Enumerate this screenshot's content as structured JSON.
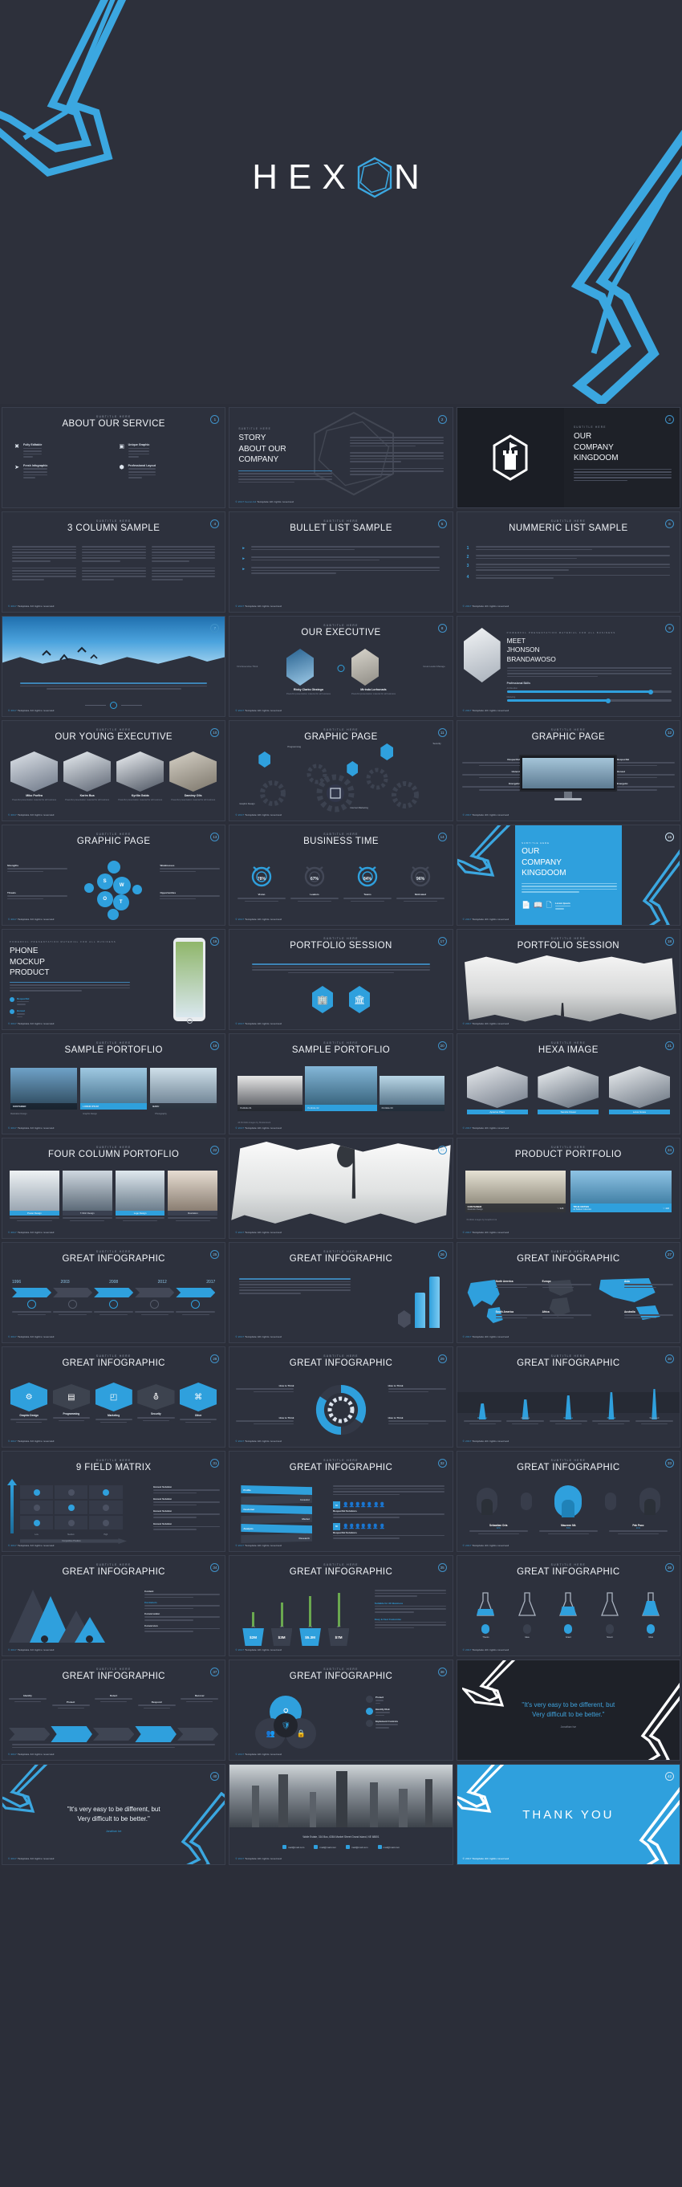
{
  "hero": {
    "brand_prefix": "HEX",
    "brand_suffix": "N",
    "brand_full": "HEXON",
    "accent_color": "#2fa0dd",
    "background_color": "#2d303b"
  },
  "common": {
    "subtitle_label": "SUBTITLE HERE",
    "footer_year": "© 2017",
    "footer_brand": "hexon.ltd",
    "footer_rights": "Template All rights reserved",
    "lorem_short": "Bring your business to the next Level with Powerful presentation material for all business and personal presentation.",
    "lorem_long": "Bring your business to the next Level with Powerful presentation material for all business. Suitable for all categories business and personal presentation If you are going to use a passage of Lorem Ipsum."
  },
  "slides": [
    {
      "number": "1",
      "subtitle": "SUBTITLE HERE",
      "title": "ABOUT OUR SERVICE",
      "type": "features",
      "features": [
        {
          "icon": "scissors-icon",
          "glyph": "✂",
          "label": "Fully Editable"
        },
        {
          "icon": "image-icon",
          "glyph": "▣",
          "label": "Unique Graphic"
        },
        {
          "icon": "rocket-icon",
          "glyph": "➤",
          "label": "Fresh Infographic"
        },
        {
          "icon": "layers-icon",
          "glyph": "⬢",
          "label": "Professional Layout"
        }
      ]
    },
    {
      "number": "2",
      "subtitle": "SUBTITLE HERE",
      "title": "STORY ABOUT OUR COMPANY",
      "title_lines": [
        "STORY",
        "ABOUT OUR",
        "COMPANY"
      ],
      "type": "story"
    },
    {
      "number": "3",
      "subtitle": "SUBTITLE HERE",
      "title": "OUR COMPANY KINGDOOM",
      "title_lines": [
        "OUR",
        "COMPANY",
        "KINGDOOM"
      ],
      "type": "company-kingdom",
      "icon": "castle-hex-icon"
    },
    {
      "number": "4",
      "subtitle": "SUBTITLE HERE",
      "title": "3 COLUMN SAMPLE",
      "type": "three-column"
    },
    {
      "number": "5",
      "subtitle": "SUBTITLE HERE",
      "title": "BULLET LIST SAMPLE",
      "type": "bullet-list",
      "bullet_glyph": "▸"
    },
    {
      "number": "6",
      "subtitle": "SUBTITLE HERE",
      "title": "NUMMERIC LIST SAMPLE",
      "type": "numeric-list",
      "numbers": [
        "1",
        "2",
        "3",
        "4"
      ]
    },
    {
      "number": "7",
      "subtitle": "",
      "title": "",
      "type": "image-brush-sky",
      "caption": "Bring your business to the next Level with Powerful presentation material for all business and personal presentation."
    },
    {
      "number": "8",
      "subtitle": "SUBTITLE HERE",
      "title": "OUR EXECUTIVE",
      "type": "executive",
      "people": [
        {
          "name": "Ricky Clarks Obstego",
          "role": "Powerful presentation material for all business"
        },
        {
          "name": "Mirinda Lorhonads",
          "role": "Powerful presentation material for all business"
        }
      ],
      "left_label": "First Executive Think",
      "right_label": "Great Leader Manage"
    },
    {
      "number": "9",
      "subtitle": "Powerful presentation material for all business",
      "title": "MEET JHONSON BRANDAWOSO",
      "title_lines": [
        "MEET",
        "JHONSON",
        "BRANDAWOSO"
      ],
      "type": "profile",
      "skills_label": "Professional Skills",
      "skills": [
        {
          "label": "Art Direction",
          "value": 88
        },
        {
          "label": "Marketing",
          "value": 62
        }
      ]
    },
    {
      "number": "10",
      "subtitle": "SUBTITLE HERE",
      "title": "OUR YOUNG EXECUTIVE",
      "type": "team",
      "members": [
        {
          "name": "Miko Porfira",
          "role": "Powerful presentation material for all business"
        },
        {
          "name": "Karim Bua",
          "role": "Powerful presentation material for all business"
        },
        {
          "name": "Kyrilla Gaida",
          "role": "Powerful presentation material for all business"
        },
        {
          "name": "Damimy Olis",
          "role": "Powerful presentation material for all business"
        }
      ]
    },
    {
      "number": "11",
      "subtitle": "SUBTITLE HERE",
      "title": "GRAPHIC PAGE",
      "type": "gears",
      "nodes": [
        "Programming",
        "Security",
        "Graphic Design",
        "Internet Marketing"
      ]
    },
    {
      "number": "12",
      "subtitle": "SUBTITLE HERE",
      "title": "GRAPHIC PAGE",
      "type": "monitor",
      "items": [
        "Respectful",
        "Honest",
        "Energetic",
        "Respectful",
        "Honest",
        "Energetic"
      ]
    },
    {
      "number": "13",
      "subtitle": "SUBTITLE HERE",
      "title": "GRAPHIC PAGE",
      "type": "swot",
      "swot_letters": [
        "S",
        "W",
        "O",
        "T"
      ],
      "swot_labels": [
        "Strengths",
        "Weaknesses",
        "Threats",
        "Opportunities"
      ]
    },
    {
      "number": "14",
      "subtitle": "SUBTITLE HERE",
      "title": "BUSINESS TIME",
      "type": "clocks",
      "clocks": [
        {
          "pct": "78%",
          "label": "Vision"
        },
        {
          "pct": "67%",
          "label": "Leaders"
        },
        {
          "pct": "84%",
          "label": "Teams"
        },
        {
          "pct": "96%",
          "label": "Motivated"
        }
      ]
    },
    {
      "number": "15",
      "subtitle": "SUBTITLE HERE",
      "title": "OUR COMPANY KINGDOOM",
      "title_lines": [
        "OUR",
        "COMPANY",
        "KINGDOOM"
      ],
      "type": "blue-panel",
      "caption": "Lorem Ipsum"
    },
    {
      "number": "16",
      "subtitle": "Powerful presentation material for all business",
      "title": "PHONE MOCKUP PRODUCT",
      "title_lines": [
        "PHONE",
        "MOCKUP",
        "PRODUCT"
      ],
      "type": "phone",
      "points": [
        "Respectful",
        "Honest"
      ]
    },
    {
      "number": "17",
      "subtitle": "SUBTITLE HERE",
      "title": "PORTFOLIO SESSION",
      "type": "portfolio-icons",
      "icons": [
        "building-icon",
        "bank-icon"
      ]
    },
    {
      "number": "18",
      "subtitle": "SUBTITLE HERE",
      "title": "PORTFOLIO SESSION",
      "type": "brush-photo"
    },
    {
      "number": "19",
      "subtitle": "SUBTITLE HERE",
      "title": "SAMPLE PORTOFLIO",
      "type": "gallery3",
      "items": [
        {
          "tag": "KONTAINER",
          "sub": "Illustration Design"
        },
        {
          "tag": "LOREM IPSUM",
          "sub": "Graphic Design"
        },
        {
          "tag": "BAKU",
          "sub": "Photography"
        }
      ]
    },
    {
      "number": "20",
      "subtitle": "SUBTITLE HERE",
      "title": "SAMPLE PORTOFLIO",
      "type": "gallery-wide",
      "items": [
        "Portfolio 01",
        "Portfolio 02",
        "Portfolio 03"
      ],
      "note": "All Portfolio images by Shutterstock"
    },
    {
      "number": "21",
      "subtitle": "SUBTITLE HERE",
      "title": "HEXA IMAGE",
      "type": "hexa-gallery",
      "items": [
        "Aplerica Plant",
        "Sandra Flower",
        "Lotus Grace"
      ]
    },
    {
      "number": "22",
      "subtitle": "SUBTITLE HERE",
      "title": "FOUR COLUMN PORTOFLIO",
      "type": "four-column",
      "items": [
        {
          "tag": "Poster Design",
          "sub": "Suitable for all categories business and personal presentation"
        },
        {
          "tag": "T-Shirt Design",
          "sub": "Suitable for all categories business and personal presentation"
        },
        {
          "tag": "Logo Design",
          "sub": "Suitable for all categories business and personal presentation"
        },
        {
          "tag": "Illustration",
          "sub": "Suitable for all categories business and personal presentation"
        }
      ]
    },
    {
      "number": "23",
      "subtitle": "",
      "title": "",
      "type": "brush-tree"
    },
    {
      "number": "24",
      "subtitle": "SUBTITLE HERE",
      "title": "PRODUCT PORTFOLIO",
      "type": "product-portfolio",
      "items": [
        {
          "tag": "KONTAINER",
          "sub": "Illustration Design",
          "likes": "328"
        },
        {
          "tag": "TRUE NOTEN",
          "sub": "Air Balloon Collection",
          "likes": "436"
        }
      ],
      "note": "Portfolio images by Graphics Ink"
    },
    {
      "number": "25",
      "subtitle": "SUBTITLE HERE",
      "title": "GREAT INFOGRAPHIC",
      "type": "timeline",
      "years": [
        "1996",
        "2003",
        "2008",
        "2012",
        "2017"
      ]
    },
    {
      "number": "26",
      "subtitle": "SUBTITLE HERE",
      "title": "GREAT INFOGRAPHIC",
      "type": "bars3d",
      "bars": [
        30,
        55,
        90
      ]
    },
    {
      "number": "27",
      "subtitle": "SUBTITLE HERE",
      "title": "GREAT INFOGRAPHIC",
      "type": "world-map",
      "regions": [
        "North America",
        "Europe",
        "Asia",
        "South America",
        "Africa",
        "Australia"
      ]
    },
    {
      "number": "28",
      "subtitle": "SUBTITLE HERE",
      "title": "GREAT INFOGRAPHIC",
      "type": "hex-icons",
      "items": [
        {
          "label": "Graphic Design",
          "glyph": "⚙"
        },
        {
          "label": "Programming",
          "glyph": "▤"
        },
        {
          "label": "Marketing",
          "glyph": "◰"
        },
        {
          "label": "Security",
          "glyph": "⛨"
        },
        {
          "label": "Other",
          "glyph": "⌘"
        }
      ]
    },
    {
      "number": "29",
      "subtitle": "SUBTITLE HERE",
      "title": "GREAT INFOGRAPHIC",
      "type": "gear-donut",
      "items": [
        "How to Think",
        "How to Think",
        "How to Think",
        "How to Think"
      ]
    },
    {
      "number": "30",
      "subtitle": "SUBTITLE HERE",
      "title": "GREAT INFOGRAPHIC",
      "type": "evolution",
      "stages": [
        "Discover",
        "Analyze",
        "Produce",
        "Present",
        "Succeed"
      ]
    },
    {
      "number": "31",
      "subtitle": "SUBTITLE HERE",
      "title": "9 FIELD MATRIX",
      "type": "matrix",
      "axis_x": "Competitive Position",
      "axis_y": "Market Growth",
      "legend": [
        "Honest Solution",
        "Honest Solution",
        "Honest Solution",
        "Honest Solution"
      ],
      "col_labels": [
        "Low",
        "Medium",
        "High"
      ]
    },
    {
      "number": "32",
      "subtitle": "SUBTITLE HERE",
      "title": "GREAT INFOGRAPHIC",
      "type": "stack-ribbon",
      "layers": [
        "Profile",
        "Investor",
        "Customer",
        "Market",
        "Analysis",
        "Research"
      ],
      "stats": [
        {
          "value": "60",
          "label": "Respectful Solutions"
        },
        {
          "value": "80",
          "label": "Respectful Solutions"
        }
      ]
    },
    {
      "number": "33",
      "subtitle": "SUBTITLE HERE",
      "title": "GREAT INFOGRAPHIC",
      "type": "people-stats",
      "people": [
        {
          "name": "Sebastian Orla",
          "pct": "32%"
        },
        {
          "name": "Maureen Mk",
          "pct": "54%"
        },
        {
          "name": "Pak Paco",
          "pct": "21%"
        }
      ]
    },
    {
      "number": "34",
      "subtitle": "SUBTITLE HERE",
      "title": "GREAT INFOGRAPHIC",
      "type": "mountains",
      "legend": [
        "Content",
        "Customers",
        "Conversation",
        "Conversion"
      ]
    },
    {
      "number": "35",
      "subtitle": "SUBTITLE HERE",
      "title": "GREAT INFOGRAPHIC",
      "type": "plants",
      "values": [
        "$2M",
        "$3M",
        "$5.3M",
        "$7M"
      ],
      "years": [
        "2014",
        "2015",
        "2016",
        "2017"
      ],
      "heads": [
        "Suitable for All Business",
        "Easy & Fast Customize"
      ]
    },
    {
      "number": "36",
      "subtitle": "SUBTITLE HERE",
      "title": "GREAT INFOGRAPHIC",
      "type": "flasks",
      "labels": [
        "Thesis",
        "Idea",
        "Grant",
        "Smart",
        "Risk"
      ]
    },
    {
      "number": "37",
      "subtitle": "SUBTITLE HERE",
      "title": "GREAT INFOGRAPHIC",
      "type": "arrow-process",
      "steps": [
        "Identify",
        "Protect",
        "Detect",
        "Respond",
        "Recover"
      ]
    },
    {
      "number": "38",
      "subtitle": "SUBTITLE HERE",
      "title": "GREAT INFOGRAPHIC",
      "type": "venn",
      "items": [
        "Protect",
        "Identify Risk",
        "Implement Controls"
      ]
    },
    {
      "number": "39",
      "subtitle": "",
      "title": "",
      "type": "quote-white",
      "quote_lines": [
        "\"It's very easy to be different, but",
        "Very difficult to be better.\""
      ],
      "author": "Jonathan Ive"
    },
    {
      "number": "40",
      "subtitle": "",
      "title": "",
      "type": "quote-dark",
      "quote_lines": [
        "\"It's very easy to be different, but",
        "Very difficult to be better.\""
      ],
      "author": "Jonathan Ive"
    },
    {
      "number": "41",
      "subtitle": "",
      "title": "",
      "type": "contact",
      "address": "Walle Estate, 316 Bus, 6384 Market Street Grand Island, NE 68801",
      "socials": [
        {
          "icon": "mail-icon",
          "label": "mail@mail.com"
        },
        {
          "icon": "twitter-icon",
          "label": "mail@mail.com"
        },
        {
          "icon": "dribbble-icon",
          "label": "mail@mail.com"
        },
        {
          "icon": "facebook-icon",
          "label": "mail@mail.com"
        }
      ]
    },
    {
      "number": "42",
      "subtitle": "",
      "title": "THANK YOU",
      "type": "thankyou"
    }
  ]
}
